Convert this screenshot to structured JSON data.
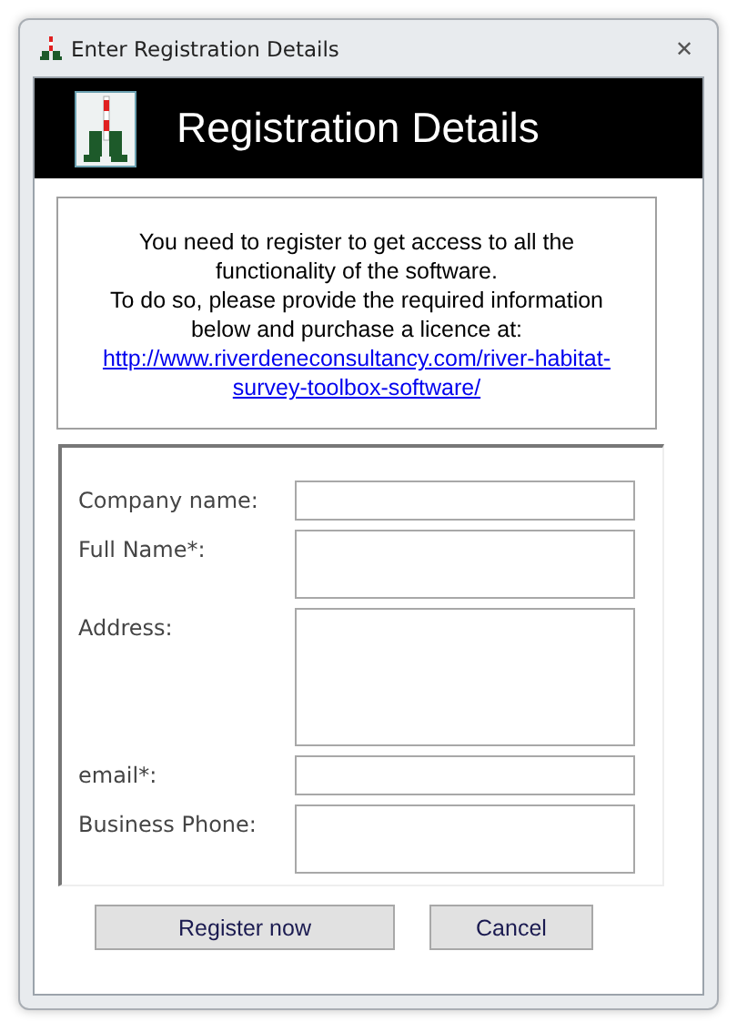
{
  "window": {
    "title": "Enter Registration Details",
    "close": "✕"
  },
  "header": {
    "title": "Registration Details"
  },
  "message": {
    "text": "You need to register to get access to all the functionality of the software.\nTo do so, please provide the required information below and purchase a licence at:",
    "link": "http://www.riverdeneconsultancy.com/river-habitat-survey-toolbox-software/"
  },
  "form": {
    "fields": [
      {
        "label": "Company name:",
        "kind": "single"
      },
      {
        "label": "Full Name*:",
        "kind": "double"
      },
      {
        "label": "Address:",
        "kind": "multi"
      },
      {
        "label": "email*:",
        "kind": "single"
      },
      {
        "label": "Business Phone:",
        "kind": "double"
      }
    ]
  },
  "buttons": [
    {
      "label": "Register now",
      "kind": "wide"
    },
    {
      "label": "Cancel",
      "kind": "narrow"
    }
  ]
}
